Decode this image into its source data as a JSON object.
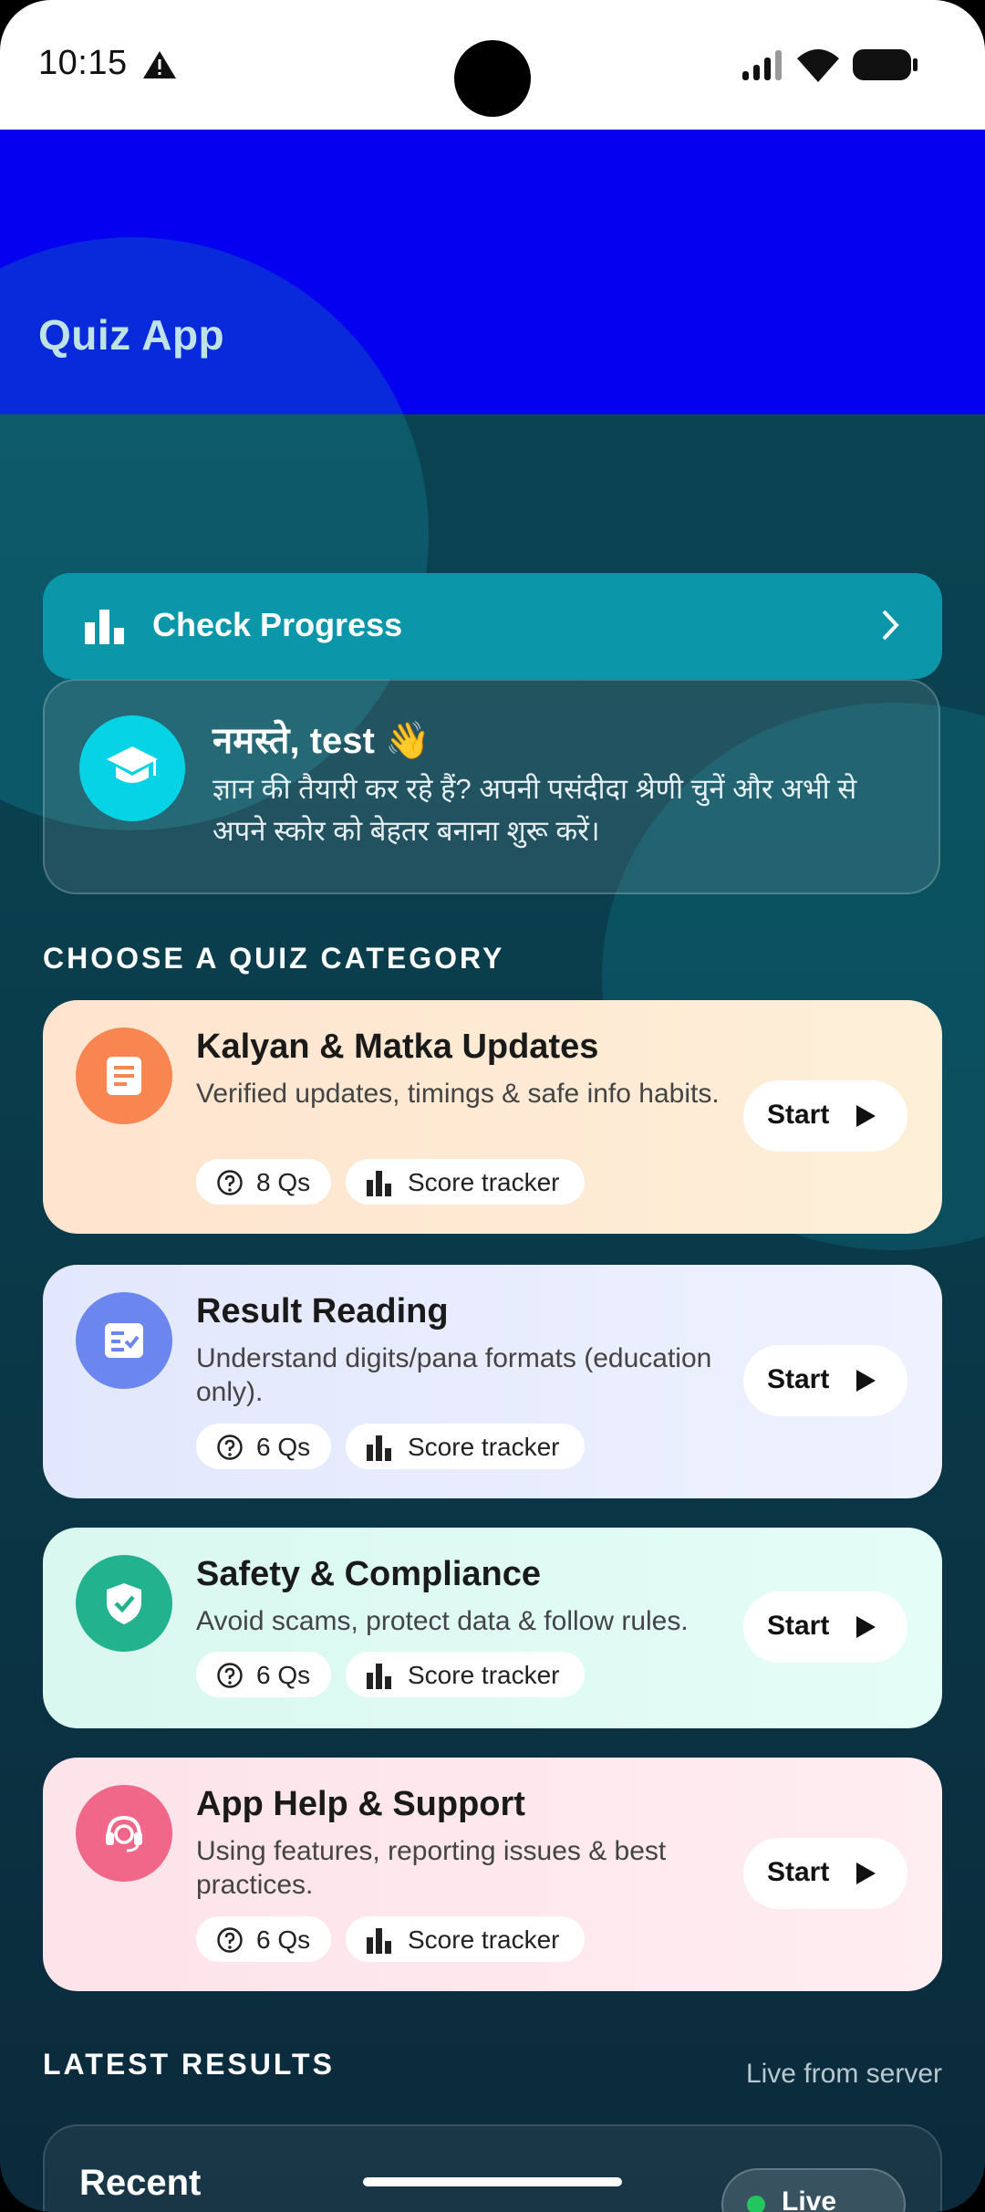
{
  "status_bar": {
    "time": "10:15"
  },
  "app_bar": {
    "title": "Quiz App",
    "color": "#0500ef"
  },
  "progress": {
    "label": "Check Progress"
  },
  "greeting": {
    "title": "नमस्ते, test 👋",
    "text": "ज्ञान की तैयारी कर रहे हैं? अपनी पसंदीदा श्रेणी चुनें और अभी से अपने स्कोर को बेहतर बनाना शुरू करें।"
  },
  "categories_section": {
    "title": "CHOOSE A QUIZ CATEGORY"
  },
  "categories": [
    {
      "title": "Kalyan & Matka Updates",
      "desc": "Verified updates, timings & safe info habits.",
      "questions": "8 Qs",
      "tracker": "Score tracker",
      "start": "Start",
      "icon": "document-icon",
      "icon_color": "#f98551"
    },
    {
      "title": "Result Reading",
      "desc": "Understand digits/pana formats (education only).",
      "questions": "6 Qs",
      "tracker": "Score tracker",
      "start": "Start",
      "icon": "checklist-icon",
      "icon_color": "#6b86ef"
    },
    {
      "title": "Safety & Compliance",
      "desc": "Avoid scams, protect data & follow rules.",
      "questions": "6 Qs",
      "tracker": "Score tracker",
      "start": "Start",
      "icon": "shield-check-icon",
      "icon_color": "#22b38e"
    },
    {
      "title": "App Help & Support",
      "desc": "Using features, reporting issues & best practices.",
      "questions": "6 Qs",
      "tracker": "Score tracker",
      "start": "Start",
      "icon": "support-agent-icon",
      "icon_color": "#f0678a"
    }
  ],
  "latest": {
    "title": "LATEST RESULTS",
    "subtitle": "Live from server"
  },
  "recent": {
    "title": "Recent",
    "badge": "Live"
  }
}
